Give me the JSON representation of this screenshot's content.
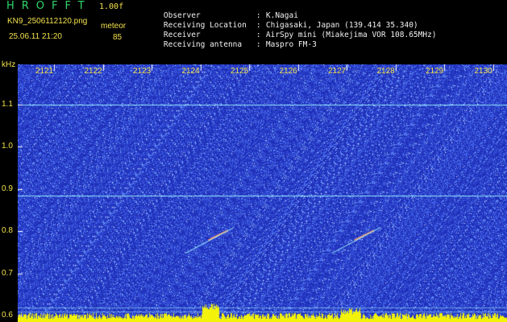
{
  "header": {
    "app_title": "HROFFT",
    "version": "1.00f",
    "filename": "KN9_2506112120.png",
    "datetime": "25.06.11 21:20",
    "meteor_label": "meteor",
    "meteor_count": "85"
  },
  "station_info": [
    {
      "key": "Observer",
      "value": "K.Nagai"
    },
    {
      "key": "Receiving Location",
      "value": "Chigasaki, Japan (139.414 35.340)"
    },
    {
      "key": "Receiver",
      "value": "AirSpy mini (Miakejima VOR 108.65MHz)"
    },
    {
      "key": "Receiving antenna",
      "value": "Maspro FM-3"
    }
  ],
  "chart_data": {
    "type": "heatmap",
    "title": "",
    "xlabel": "",
    "ylabel": "kHz",
    "x_ticks": [
      "2121",
      "2122",
      "2123",
      "2124",
      "2125",
      "2126",
      "2127",
      "2128",
      "2129",
      "2130"
    ],
    "y_ticks": [
      "1.1",
      "1.0",
      "0.9",
      "0.8",
      "0.7",
      "0.6"
    ],
    "ylim": [
      0.585,
      1.195
    ],
    "horizontal_lines_khz": [
      1.1,
      0.885,
      0.62,
      0.61
    ],
    "meteor_echoes": [
      {
        "time": "2124",
        "freq_khz": 0.79
      },
      {
        "time": "2127",
        "freq_khz": 0.79
      }
    ],
    "colors": {
      "background": "#1f2fb8",
      "noise": "#6f90ff",
      "line": "#9cf3ff",
      "bottom_bar": "#f2f20a"
    }
  }
}
